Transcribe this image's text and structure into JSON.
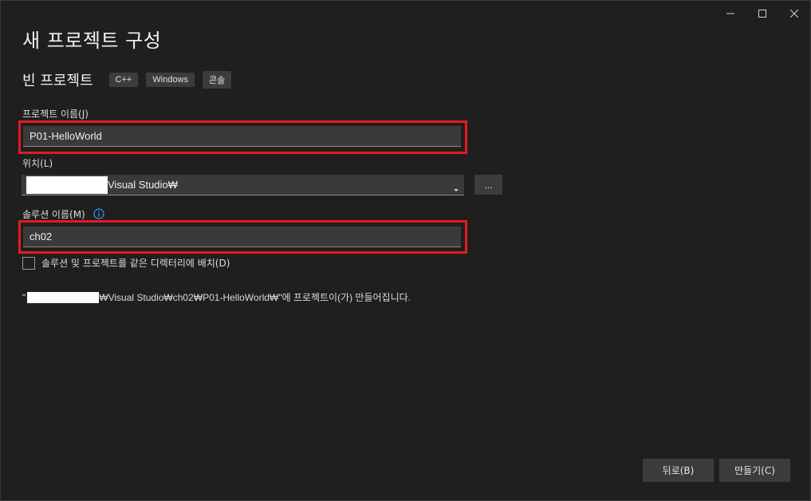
{
  "window_controls": {
    "minimize_icon": "minimize-icon",
    "maximize_icon": "maximize-icon",
    "close_icon": "close-icon"
  },
  "dialog": {
    "title": "새 프로젝트 구성",
    "template_name": "빈 프로젝트",
    "tags": [
      "C++",
      "Windows",
      "콘솔"
    ]
  },
  "project_name": {
    "label": "프로젝트 이름(J)",
    "value": "P01-HelloWorld"
  },
  "location": {
    "label": "위치(L)",
    "value_suffix": "Visual Studio₩",
    "browse_label": "...",
    "dropdown_icon": "chevron-down-icon"
  },
  "solution_name": {
    "label": "솔루션 이름(M)",
    "value": "ch02",
    "info_icon": "info-icon"
  },
  "same_directory": {
    "label": "솔루션 및 프로젝트를 같은 디렉터리에 배치(D)",
    "checked": false
  },
  "creation_path": {
    "prefix": "\"",
    "text": "₩Visual Studio₩ch02₩P01-HelloWorld₩\"에 프로젝트이(가) 만들어집니다."
  },
  "footer": {
    "back_label": "뒤로(B)",
    "create_label": "만들기(C)"
  },
  "colors": {
    "background": "#1f1f1f",
    "input_bg": "#3a3a3a",
    "highlight": "#e21b23",
    "info_blue": "#3794ff"
  }
}
